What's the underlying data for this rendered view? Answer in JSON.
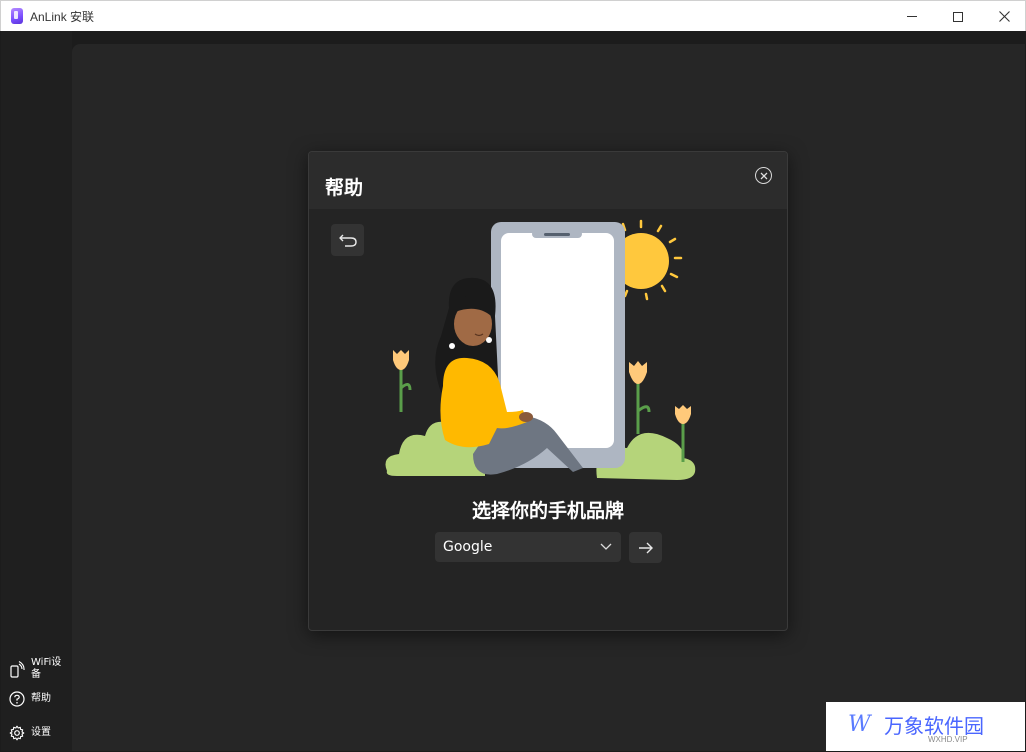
{
  "window": {
    "title": "AnLink 安联",
    "controls": [
      "minimize",
      "maximize",
      "close"
    ]
  },
  "sidebar": {
    "items": [
      {
        "label": "WiFi设备",
        "icon": "wifi-phone-icon"
      },
      {
        "label": "帮助",
        "icon": "help-icon"
      },
      {
        "label": "设置",
        "icon": "gear-icon"
      }
    ]
  },
  "dialog": {
    "title": "帮助",
    "prompt": "选择你的手机品牌",
    "brand_select": {
      "value": "Google"
    },
    "icons": {
      "close": "close-circle-icon",
      "back": "back-arrow-icon",
      "next": "arrow-right-icon"
    }
  },
  "watermark": {
    "logo": "W",
    "text": "万象软件园",
    "sub": "WXHD.VIP"
  },
  "colors": {
    "background": "#1c1c1c",
    "panel": "#262626",
    "dialog": "#242424",
    "control": "#333333",
    "text": "#ffffff",
    "accent_yellow": "#ffb900"
  }
}
